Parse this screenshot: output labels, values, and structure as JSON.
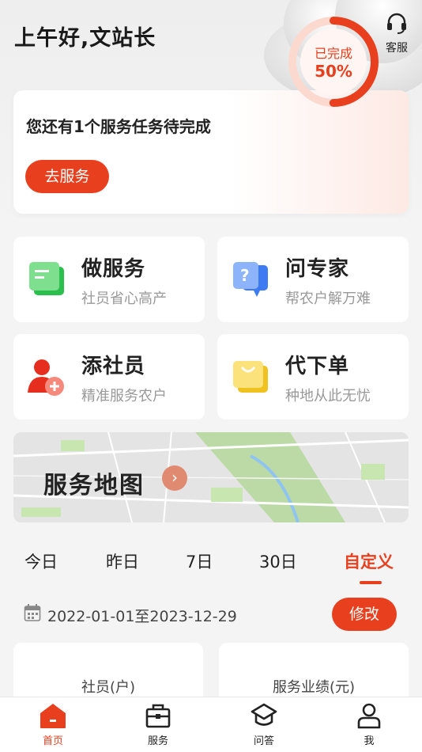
{
  "header": {
    "greeting": "上午好,文站长",
    "customer_service_label": "客服"
  },
  "task": {
    "text": "您还有1个服务任务待完成",
    "button_label": "去服务",
    "progress_label": "已完成",
    "progress_percent_text": "50%",
    "progress_fraction": 0.5
  },
  "grid": [
    {
      "title": "做服务",
      "subtitle": "社员省心高产",
      "icon": "document-icon"
    },
    {
      "title": "问专家",
      "subtitle": "帮农户解万难",
      "icon": "chat-question-icon"
    },
    {
      "title": "添社员",
      "subtitle": "精准服务农户",
      "icon": "add-member-icon"
    },
    {
      "title": "代下单",
      "subtitle": "种地从此无忧",
      "icon": "shopping-bag-icon"
    }
  ],
  "map": {
    "title": "服务地图",
    "arrow_icon": "chevron-right-icon"
  },
  "period_tabs": [
    "今日",
    "昨日",
    "7日",
    "30日",
    "自定义"
  ],
  "active_tab": "自定义",
  "date_range": {
    "text": "2022-01-01至2023-12-29",
    "icon": "calendar-icon",
    "modify_label": "修改"
  },
  "stats": [
    {
      "label": "社员(户)"
    },
    {
      "label": "服务业绩(元)"
    }
  ],
  "bottom_nav": [
    {
      "label": "首页",
      "icon": "home-icon",
      "active": true
    },
    {
      "label": "服务",
      "icon": "briefcase-icon",
      "active": false
    },
    {
      "label": "问答",
      "icon": "graduation-cap-icon",
      "active": false
    },
    {
      "label": "我",
      "icon": "user-icon",
      "active": false
    }
  ],
  "colors": {
    "accent": "#e8401e",
    "background": "#f4f4f5"
  }
}
